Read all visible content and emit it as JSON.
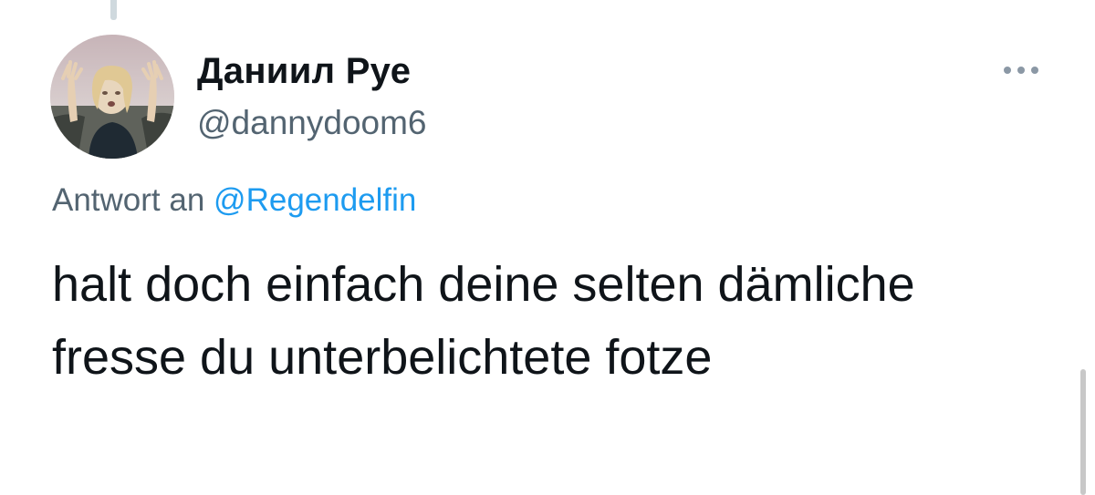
{
  "tweet": {
    "author": {
      "display_name": "Даниил Руе",
      "handle": "@dannydoom6"
    },
    "reply_prefix": "Antwort an",
    "reply_to_handle": "@Regendelfin",
    "text": "halt doch einfach deine selten dämliche fresse du unterbelichtete fotze"
  },
  "icons": {
    "more": "more-horizontal-icon"
  },
  "colors": {
    "mention": "#1d9bf0",
    "secondary_text": "#536471",
    "primary_text": "#0f1419"
  }
}
